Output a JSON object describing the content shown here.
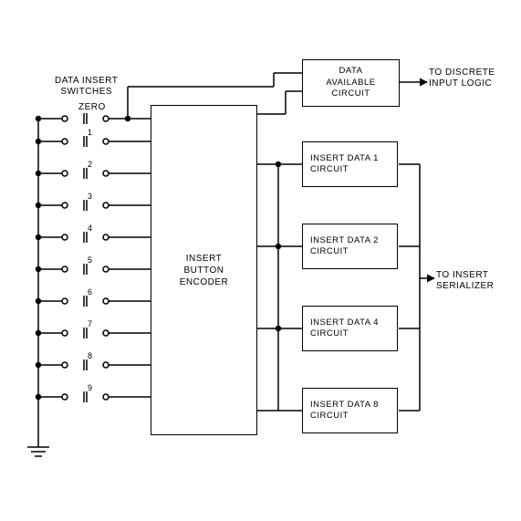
{
  "labels": {
    "data_insert_switches": "DATA INSERT\nSWITCHES",
    "zero": "ZERO",
    "to_discrete": "TO DISCRETE\nINPUT LOGIC",
    "to_serializer": "TO INSERT\nSERIALIZER"
  },
  "blocks": {
    "encoder": "INSERT\nBUTTON\nENCODER",
    "data_available": "DATA\nAVAILABLE\nCIRCUIT",
    "insert_data_1": "INSERT DATA 1\nCIRCUIT",
    "insert_data_2": "INSERT DATA 2\nCIRCUIT",
    "insert_data_4": "INSERT DATA 4\nCIRCUIT",
    "insert_data_8": "INSERT DATA 8\nCIRCUIT"
  },
  "switches": [
    "1",
    "2",
    "3",
    "4",
    "5",
    "6",
    "7",
    "8",
    "9"
  ]
}
